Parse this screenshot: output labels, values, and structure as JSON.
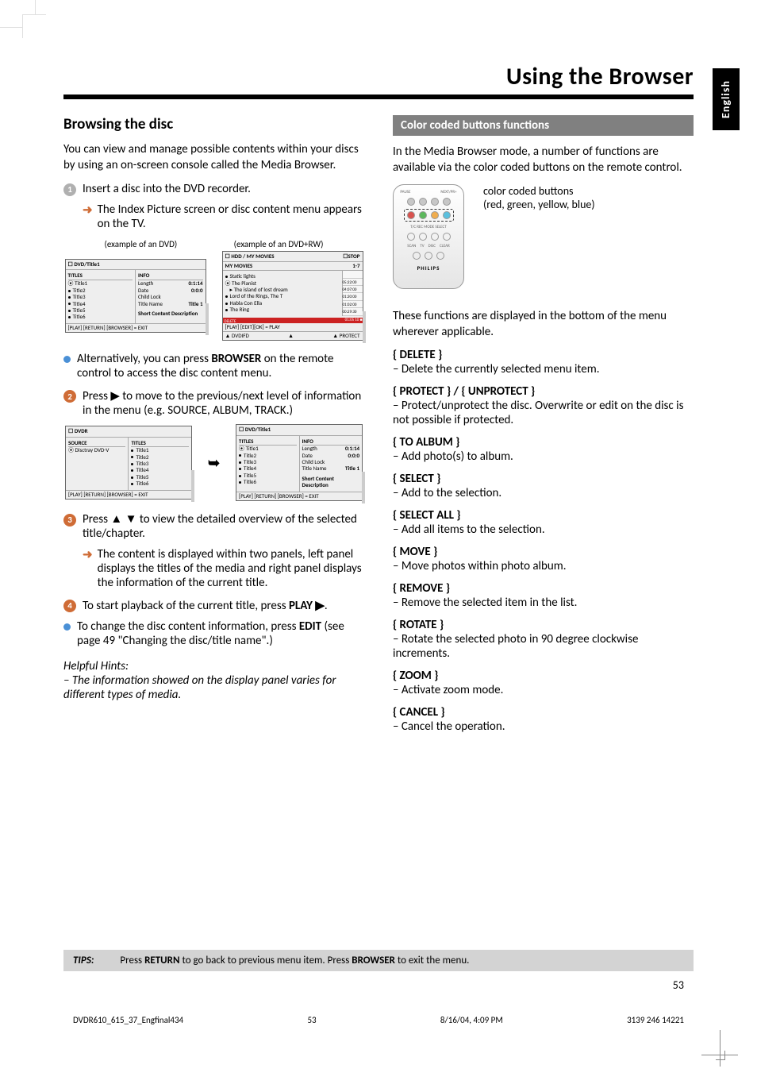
{
  "header": {
    "title": "Using the Browser"
  },
  "sideTab": "English",
  "left": {
    "heading": "Browsing the disc",
    "intro": "You can view and manage possible contents within your discs by using an on-screen console called the Media Browser.",
    "step1": "Insert a disc into the DVD recorder.",
    "step1_arrow": "The Index Picture screen or disc content menu appears on the TV.",
    "caption1": "(example of an DVD)",
    "caption2": "(example of an DVD+RW)",
    "altBullet": "Alternatively, you can press ",
    "altBullet_bold": "BROWSER",
    "altBullet_tail": " on the remote control to access the disc content menu.",
    "step2": "Press ▶ to move to the previous/next level of information in the menu (e.g. SOURCE, ALBUM, TRACK.)",
    "step3": "Press ▲ ▼ to view the detailed overview of the selected title/chapter.",
    "step3_arrow": "The content is displayed within two panels, left panel displays the titles of the media and right panel displays the information of the current title.",
    "step4_a": "To start playback of the current title, press ",
    "step4_bold": "PLAY ▶",
    "step4_b": ".",
    "bullet2_a": "To change the disc content information, press ",
    "bullet2_bold": "EDIT",
    "bullet2_b": " (see page 49 \"Changing the disc/title name\".)",
    "hints_title": "Helpful Hints:",
    "hints_body": "–  The information showed on the display panel varies for different types of media."
  },
  "right": {
    "band": "Color coded buttons functions",
    "intro": "In the Media Browser mode, a number of functions are available via the color coded buttons on the remote control.",
    "remote_caption1": "color coded buttons",
    "remote_caption2": "(red, green, yellow, blue)",
    "remote_logo": "PHILIPS",
    "mid": "These functions are displayed in the bottom of the menu wherever applicable.",
    "functions": [
      {
        "label": "{ DELETE }",
        "desc": "–  Delete the currently selected menu item."
      },
      {
        "label": "{ PROTECT } / { UNPROTECT }",
        "desc": "–   Protect/unprotect the disc.  Overwrite or edit on the disc is not possible if protected."
      },
      {
        "label": "{ TO ALBUM }",
        "desc": "–   Add photo(s) to album."
      },
      {
        "label": "{ SELECT }",
        "desc": "–   Add to the selection."
      },
      {
        "label": "{ SELECT ALL }",
        "desc": "–   Add all items to the selection."
      },
      {
        "label": "{ MOVE }",
        "desc": "–   Move photos within photo album."
      },
      {
        "label": "{ REMOVE }",
        "desc": "–   Remove the selected item in the list."
      },
      {
        "label": "{ ROTATE }",
        "desc": "–   Rotate the selected photo in 90 degree clockwise increments."
      },
      {
        "label": "{ ZOOM }",
        "desc": "–   Activate zoom mode."
      },
      {
        "label": "{ CANCEL }",
        "desc": "–   Cancel the operation."
      }
    ]
  },
  "tips": {
    "label": "TIPS:",
    "text": " Press RETURN to go back to previous menu item.  Press BROWSER to exit the menu."
  },
  "pageNumber": "53",
  "footer": {
    "left": "DVDR610_615_37_Engfinal434",
    "mid": "53",
    "right1": "8/16/04, 4:09 PM",
    "right2": "3139 246 14221"
  },
  "osd": {
    "dvd1": {
      "hdrL": "DVD/Title1",
      "hdrR": "",
      "titlesLabel": "TITLES",
      "infoLabel": "INFO",
      "items": [
        "Title1",
        "Title2",
        "Title3",
        "Title4",
        "Title5",
        "Title6"
      ],
      "info": [
        [
          "Length",
          "0:1:14"
        ],
        [
          "Date",
          "0:0:0"
        ],
        [
          "Child Lock",
          ""
        ],
        [
          "Title Name",
          "Title 1"
        ],
        [
          "",
          ""
        ],
        [
          "Short Content Description",
          ""
        ]
      ],
      "ftr": "[PLAY] [RETURN]  [BROWSER] = EXIT"
    },
    "rw": {
      "hdrL": "HDD / MY MOVIES",
      "hdrR": "STOP",
      "label": "MY MOVIES",
      "range": "1-7",
      "items": [
        "Static lights",
        "The Pianist",
        "The island of lost dream",
        "Lord of the Rings, The T",
        "Habla Con Ella",
        "The Ring"
      ],
      "times": [
        "05:22:00",
        "00",
        "04:07:00",
        "01:20:00",
        "00",
        "01:02:00",
        "01:02:00",
        "00",
        "00:29:30"
      ],
      "del": "DELETE",
      "ftrL": "[PLAY] [EDIT][OK] = PLAY",
      "ftrBL": "DVDIFD",
      "ftrBR": "PROTECT",
      "bar": "01:05  10 ■"
    },
    "src": {
      "hdr": "DVDR",
      "srcLabel": "SOURCE",
      "titlesLabel": "TITLES",
      "src": "Disctray DVD-V",
      "items": [
        "Title1",
        "Title2",
        "Title3",
        "Title4",
        "Title5",
        "Title6"
      ],
      "ftr": "[PLAY] [RETURN]  [BROWSER] = EXIT"
    }
  }
}
